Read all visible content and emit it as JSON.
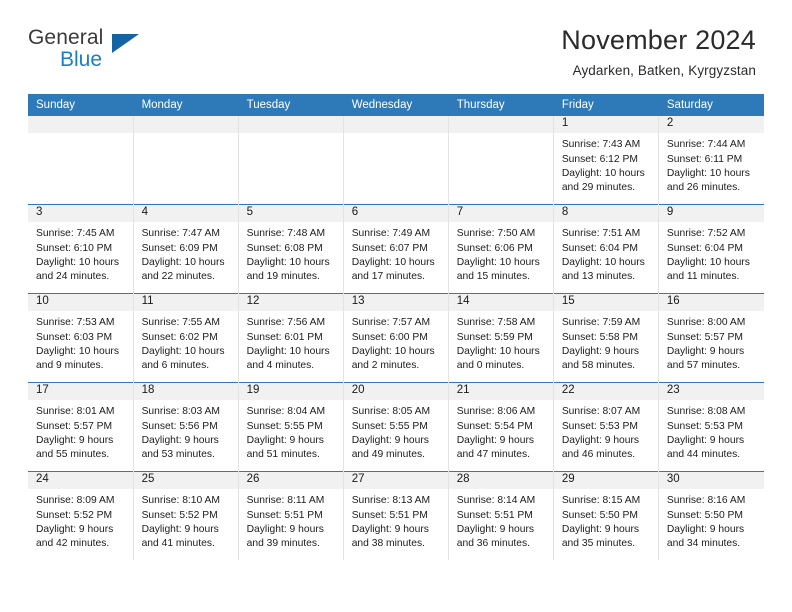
{
  "brand": {
    "word_one": "General",
    "word_two": "Blue",
    "triangle_color": "#1464a5",
    "blue_text_color": "#1b7fc4"
  },
  "header": {
    "title": "November 2024",
    "subtitle": "Aydarken, Batken, Kyrgyzstan"
  },
  "theme": {
    "header_blue": "#2e7ab8",
    "daynum_band": "#f1f1f1",
    "grid_line": "#e3e3e3"
  },
  "weekday_headers": [
    "Sunday",
    "Monday",
    "Tuesday",
    "Wednesday",
    "Thursday",
    "Friday",
    "Saturday"
  ],
  "weeks": [
    [
      {
        "day": "",
        "sunrise": "",
        "sunset": "",
        "daylight_line1": "",
        "daylight_line2": ""
      },
      {
        "day": "",
        "sunrise": "",
        "sunset": "",
        "daylight_line1": "",
        "daylight_line2": ""
      },
      {
        "day": "",
        "sunrise": "",
        "sunset": "",
        "daylight_line1": "",
        "daylight_line2": ""
      },
      {
        "day": "",
        "sunrise": "",
        "sunset": "",
        "daylight_line1": "",
        "daylight_line2": ""
      },
      {
        "day": "",
        "sunrise": "",
        "sunset": "",
        "daylight_line1": "",
        "daylight_line2": ""
      },
      {
        "day": "1",
        "sunrise": "Sunrise: 7:43 AM",
        "sunset": "Sunset: 6:12 PM",
        "daylight_line1": "Daylight: 10 hours",
        "daylight_line2": "and 29 minutes."
      },
      {
        "day": "2",
        "sunrise": "Sunrise: 7:44 AM",
        "sunset": "Sunset: 6:11 PM",
        "daylight_line1": "Daylight: 10 hours",
        "daylight_line2": "and 26 minutes."
      }
    ],
    [
      {
        "day": "3",
        "sunrise": "Sunrise: 7:45 AM",
        "sunset": "Sunset: 6:10 PM",
        "daylight_line1": "Daylight: 10 hours",
        "daylight_line2": "and 24 minutes."
      },
      {
        "day": "4",
        "sunrise": "Sunrise: 7:47 AM",
        "sunset": "Sunset: 6:09 PM",
        "daylight_line1": "Daylight: 10 hours",
        "daylight_line2": "and 22 minutes."
      },
      {
        "day": "5",
        "sunrise": "Sunrise: 7:48 AM",
        "sunset": "Sunset: 6:08 PM",
        "daylight_line1": "Daylight: 10 hours",
        "daylight_line2": "and 19 minutes."
      },
      {
        "day": "6",
        "sunrise": "Sunrise: 7:49 AM",
        "sunset": "Sunset: 6:07 PM",
        "daylight_line1": "Daylight: 10 hours",
        "daylight_line2": "and 17 minutes."
      },
      {
        "day": "7",
        "sunrise": "Sunrise: 7:50 AM",
        "sunset": "Sunset: 6:06 PM",
        "daylight_line1": "Daylight: 10 hours",
        "daylight_line2": "and 15 minutes."
      },
      {
        "day": "8",
        "sunrise": "Sunrise: 7:51 AM",
        "sunset": "Sunset: 6:04 PM",
        "daylight_line1": "Daylight: 10 hours",
        "daylight_line2": "and 13 minutes."
      },
      {
        "day": "9",
        "sunrise": "Sunrise: 7:52 AM",
        "sunset": "Sunset: 6:04 PM",
        "daylight_line1": "Daylight: 10 hours",
        "daylight_line2": "and 11 minutes."
      }
    ],
    [
      {
        "day": "10",
        "sunrise": "Sunrise: 7:53 AM",
        "sunset": "Sunset: 6:03 PM",
        "daylight_line1": "Daylight: 10 hours",
        "daylight_line2": "and 9 minutes."
      },
      {
        "day": "11",
        "sunrise": "Sunrise: 7:55 AM",
        "sunset": "Sunset: 6:02 PM",
        "daylight_line1": "Daylight: 10 hours",
        "daylight_line2": "and 6 minutes."
      },
      {
        "day": "12",
        "sunrise": "Sunrise: 7:56 AM",
        "sunset": "Sunset: 6:01 PM",
        "daylight_line1": "Daylight: 10 hours",
        "daylight_line2": "and 4 minutes."
      },
      {
        "day": "13",
        "sunrise": "Sunrise: 7:57 AM",
        "sunset": "Sunset: 6:00 PM",
        "daylight_line1": "Daylight: 10 hours",
        "daylight_line2": "and 2 minutes."
      },
      {
        "day": "14",
        "sunrise": "Sunrise: 7:58 AM",
        "sunset": "Sunset: 5:59 PM",
        "daylight_line1": "Daylight: 10 hours",
        "daylight_line2": "and 0 minutes."
      },
      {
        "day": "15",
        "sunrise": "Sunrise: 7:59 AM",
        "sunset": "Sunset: 5:58 PM",
        "daylight_line1": "Daylight: 9 hours",
        "daylight_line2": "and 58 minutes."
      },
      {
        "day": "16",
        "sunrise": "Sunrise: 8:00 AM",
        "sunset": "Sunset: 5:57 PM",
        "daylight_line1": "Daylight: 9 hours",
        "daylight_line2": "and 57 minutes."
      }
    ],
    [
      {
        "day": "17",
        "sunrise": "Sunrise: 8:01 AM",
        "sunset": "Sunset: 5:57 PM",
        "daylight_line1": "Daylight: 9 hours",
        "daylight_line2": "and 55 minutes."
      },
      {
        "day": "18",
        "sunrise": "Sunrise: 8:03 AM",
        "sunset": "Sunset: 5:56 PM",
        "daylight_line1": "Daylight: 9 hours",
        "daylight_line2": "and 53 minutes."
      },
      {
        "day": "19",
        "sunrise": "Sunrise: 8:04 AM",
        "sunset": "Sunset: 5:55 PM",
        "daylight_line1": "Daylight: 9 hours",
        "daylight_line2": "and 51 minutes."
      },
      {
        "day": "20",
        "sunrise": "Sunrise: 8:05 AM",
        "sunset": "Sunset: 5:55 PM",
        "daylight_line1": "Daylight: 9 hours",
        "daylight_line2": "and 49 minutes."
      },
      {
        "day": "21",
        "sunrise": "Sunrise: 8:06 AM",
        "sunset": "Sunset: 5:54 PM",
        "daylight_line1": "Daylight: 9 hours",
        "daylight_line2": "and 47 minutes."
      },
      {
        "day": "22",
        "sunrise": "Sunrise: 8:07 AM",
        "sunset": "Sunset: 5:53 PM",
        "daylight_line1": "Daylight: 9 hours",
        "daylight_line2": "and 46 minutes."
      },
      {
        "day": "23",
        "sunrise": "Sunrise: 8:08 AM",
        "sunset": "Sunset: 5:53 PM",
        "daylight_line1": "Daylight: 9 hours",
        "daylight_line2": "and 44 minutes."
      }
    ],
    [
      {
        "day": "24",
        "sunrise": "Sunrise: 8:09 AM",
        "sunset": "Sunset: 5:52 PM",
        "daylight_line1": "Daylight: 9 hours",
        "daylight_line2": "and 42 minutes."
      },
      {
        "day": "25",
        "sunrise": "Sunrise: 8:10 AM",
        "sunset": "Sunset: 5:52 PM",
        "daylight_line1": "Daylight: 9 hours",
        "daylight_line2": "and 41 minutes."
      },
      {
        "day": "26",
        "sunrise": "Sunrise: 8:11 AM",
        "sunset": "Sunset: 5:51 PM",
        "daylight_line1": "Daylight: 9 hours",
        "daylight_line2": "and 39 minutes."
      },
      {
        "day": "27",
        "sunrise": "Sunrise: 8:13 AM",
        "sunset": "Sunset: 5:51 PM",
        "daylight_line1": "Daylight: 9 hours",
        "daylight_line2": "and 38 minutes."
      },
      {
        "day": "28",
        "sunrise": "Sunrise: 8:14 AM",
        "sunset": "Sunset: 5:51 PM",
        "daylight_line1": "Daylight: 9 hours",
        "daylight_line2": "and 36 minutes."
      },
      {
        "day": "29",
        "sunrise": "Sunrise: 8:15 AM",
        "sunset": "Sunset: 5:50 PM",
        "daylight_line1": "Daylight: 9 hours",
        "daylight_line2": "and 35 minutes."
      },
      {
        "day": "30",
        "sunrise": "Sunrise: 8:16 AM",
        "sunset": "Sunset: 5:50 PM",
        "daylight_line1": "Daylight: 9 hours",
        "daylight_line2": "and 34 minutes."
      }
    ]
  ]
}
